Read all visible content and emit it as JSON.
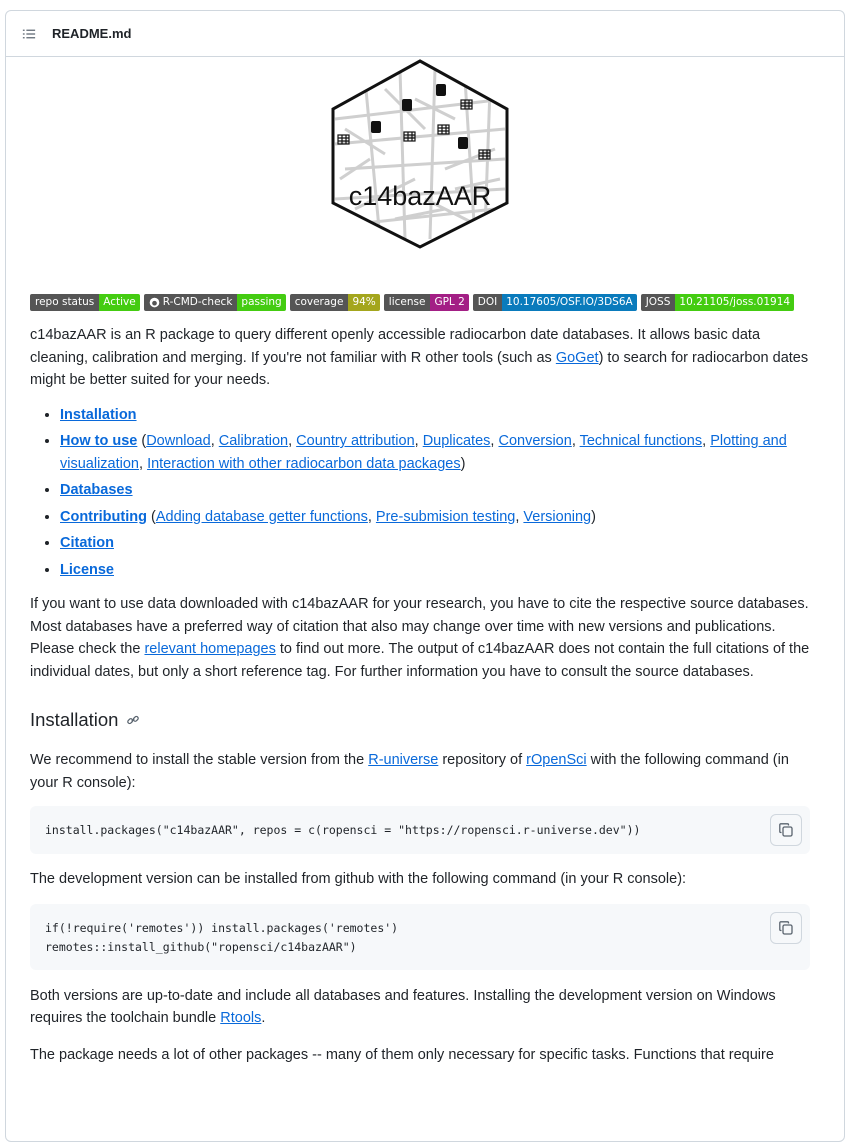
{
  "header": {
    "title": "README.md",
    "icon": "list-unordered-icon"
  },
  "logo": {
    "text": "c14bazAAR"
  },
  "badges": [
    {
      "left": "repo status",
      "right": "Active",
      "color": "#4c1"
    },
    {
      "left": "R-CMD-check",
      "right": "passing",
      "color": "#4c1",
      "icon": "github-icon"
    },
    {
      "left": "coverage",
      "right": "94%",
      "color": "#a4a61d"
    },
    {
      "left": "license",
      "right": "GPL 2",
      "color": "#a31f85"
    },
    {
      "left": "DOI",
      "right": "10.17605/OSF.IO/3DS6A",
      "color": "#0a7bbc"
    },
    {
      "left": "JOSS",
      "right": "10.21105/joss.01914",
      "color": "#4c1"
    }
  ],
  "intro": {
    "part1": "c14bazAAR is an R package to query different openly accessible radiocarbon date databases. It allows basic data cleaning, calibration and merging. If you're not familiar with R other tools (such as ",
    "link": "GoGet",
    "part2": ") to search for radiocarbon dates might be better suited for your needs."
  },
  "toc": {
    "installation": "Installation",
    "howto": "How to use",
    "howto_sub": [
      "Download",
      "Calibration",
      "Country attribution",
      "Duplicates",
      "Conversion",
      "Technical functions",
      "Plotting and visualization",
      "Interaction with other radiocarbon data packages"
    ],
    "databases": "Databases",
    "contributing": "Contributing",
    "contributing_sub": [
      "Adding database getter functions",
      "Pre-submision testing",
      "Versioning"
    ],
    "citation": "Citation",
    "license": "License"
  },
  "citation_text": {
    "part1": "If you want to use data downloaded with c14bazAAR for your research, you have to cite the respective source databases. Most databases have a preferred way of citation that also may change over time with new versions and publications. Please check the ",
    "link": "relevant homepages",
    "part2": " to find out more. The output of c14bazAAR does not contain the full citations of the individual dates, but only a short reference tag. For further information you have to consult the source databases."
  },
  "installation": {
    "heading": "Installation",
    "p1_a": "We recommend to install the stable version from the ",
    "p1_link1": "R-universe",
    "p1_b": " repository of ",
    "p1_link2": "rOpenSci",
    "p1_c": " with the following command (in your R console):",
    "code1": "install.packages(\"c14bazAAR\", repos = c(ropensci = \"https://ropensci.r-universe.dev\"))",
    "p2": "The development version can be installed from github with the following command (in your R console):",
    "code2_line1": "if(!require('remotes')) install.packages('remotes')",
    "code2_line2": "remotes::install_github(\"ropensci/c14bazAAR\")",
    "p3_a": "Both versions are up-to-date and include all databases and features. Installing the development version on Windows requires the toolchain bundle ",
    "p3_link": "Rtools",
    "p3_b": ".",
    "p4": "The package needs a lot of other packages -- many of them only necessary for specific tasks. Functions that require"
  }
}
